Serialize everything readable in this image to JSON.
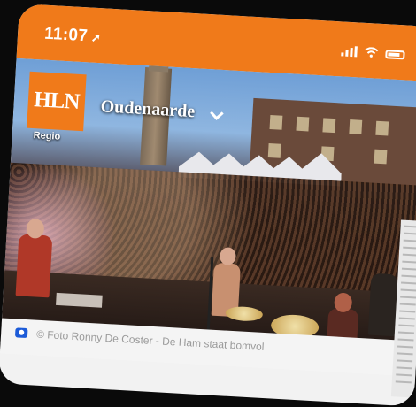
{
  "status_bar": {
    "time": "11:07",
    "location_icon": "location-arrow-icon",
    "icons": [
      "signal-icon",
      "wifi-icon",
      "battery-icon"
    ],
    "color": "#f07a1a"
  },
  "header": {
    "logo": "HLN",
    "logo_sub": "Regio",
    "city": "Oudenaarde",
    "dropdown_icon": "chevron-down-icon"
  },
  "hero_image": {
    "caption": "© Foto Ronny De Coster - De Ham staat bomvol"
  }
}
